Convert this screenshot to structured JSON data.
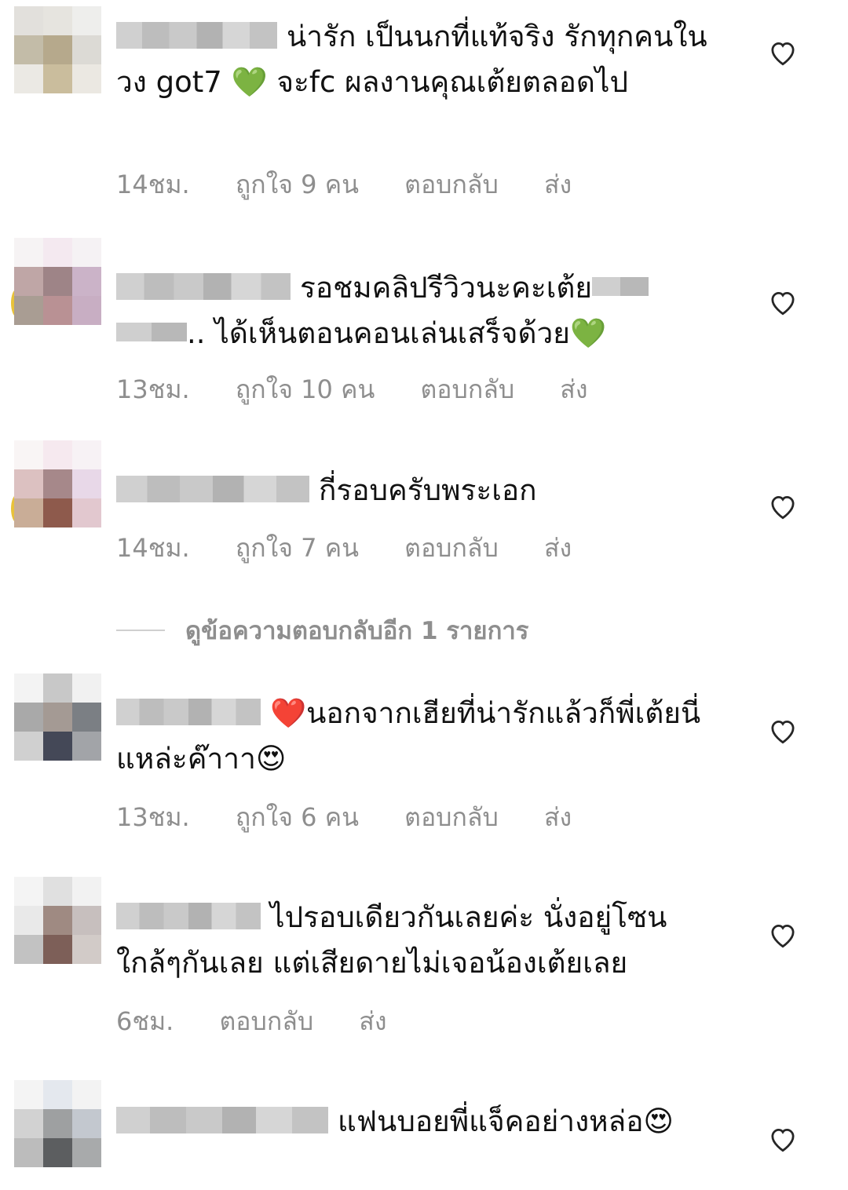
{
  "comments": [
    {
      "text": "น่ารัก เป็นนกที่แท้จริง รักทุกคนในวง  got7 💚  จะfc ผลงานคุณเต้ยตลอดไป",
      "time": "14ชม.",
      "likes": "ถูกใจ 9 คน",
      "reply": "ตอบกลับ",
      "send": "ส่ง",
      "username_redacted": true
    },
    {
      "text_before": "รอชมคลิปรีวิวนะคะเต้ย",
      "text_after": ".. ได้เห็นตอนคอนเล่นเสร็จด้วย💚",
      "time": "13ชม.",
      "likes": "ถูกใจ 10 คน",
      "reply": "ตอบกลับ",
      "send": "ส่ง"
    },
    {
      "text": "กี่รอบครับพระเอก",
      "time": "14ชม.",
      "likes": "ถูกใจ 7 คน",
      "reply": "ตอบกลับ",
      "send": "ส่ง"
    },
    {
      "text": "❤️นอกจากเฮียที่น่ารักแล้วก็พี่เต้ยนี่แหล่ะค๊าาา😍",
      "time": "13ชม.",
      "likes": "ถูกใจ 6 คน",
      "reply": "ตอบกลับ",
      "send": "ส่ง"
    },
    {
      "text": "ไปรอบเดียวกันเลยค่ะ นั่งอยู่โซนใกล้ๆกันเลย แต่เสียดายไม่เจอน้องเต้ยเลย",
      "time": "6ชม.",
      "reply": "ตอบกลับ",
      "send": "ส่ง"
    },
    {
      "text": "แฟนบอยพี่แจ็คอย่างหล่อ😍"
    }
  ],
  "view_replies": "ดูข้อความตอบกลับอีก 1 รายการ",
  "icons": {
    "like": "heart-outline-icon"
  },
  "colors": {
    "meta": "#8e8e8e",
    "text": "#111111"
  }
}
